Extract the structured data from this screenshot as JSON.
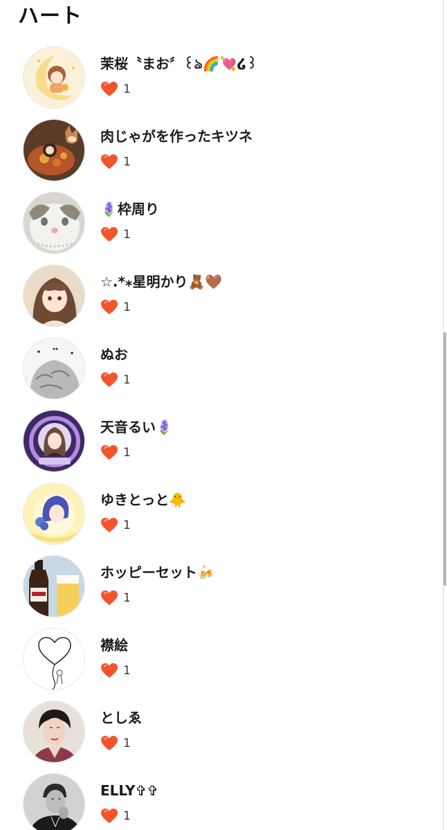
{
  "header": {
    "title": "ハート"
  },
  "reaction": {
    "icon": "heart-icon",
    "color": "#f2542d"
  },
  "users": [
    {
      "name": "茉桜〝まお〞꒰ঌ🌈💘໒꒱",
      "count": "1",
      "avatar": "anime-girl-on-moon"
    },
    {
      "name": "肉じゃがを作ったキツネ",
      "count": "1",
      "avatar": "nikujaga-fox"
    },
    {
      "name": "🪻枠周り",
      "count": "1",
      "avatar": "white-cat"
    },
    {
      "name": "☆.*⁎星明かり🧸🤎",
      "count": "1",
      "avatar": "anime-girl-sweater"
    },
    {
      "name": "ぬお",
      "count": "1",
      "avatar": "sketch-character"
    },
    {
      "name": "天音るい🪻",
      "count": "1",
      "avatar": "lilac-frame"
    },
    {
      "name": "ゆきとっと🐥",
      "count": "1",
      "avatar": "yellow-character"
    },
    {
      "name": "ホッピーセット🍻",
      "count": "1",
      "avatar": "hoppy-bottle"
    },
    {
      "name": "襟絵",
      "count": "1",
      "avatar": "heart-balloon-drawing"
    },
    {
      "name": "としゑ",
      "count": "1",
      "avatar": "woman-portrait"
    },
    {
      "name": "ELLY✞✞",
      "count": "1",
      "avatar": "man-portrait"
    }
  ]
}
